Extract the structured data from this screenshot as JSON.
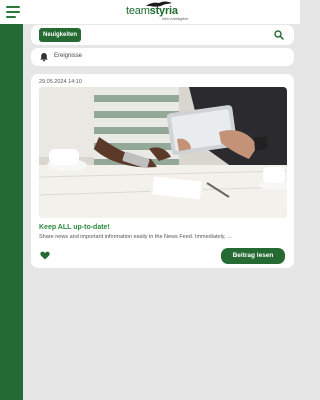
{
  "header": {
    "logo_text_team": "team",
    "logo_text_styria": "styria",
    "logo_sub": "Mein Arbeitgeber"
  },
  "filter": {
    "chip_label": "Neuigkeiten"
  },
  "events": {
    "label": "Ereignisse"
  },
  "post": {
    "date": "29.05.2024 14:10",
    "title": "Keep ALL up-to-date!",
    "excerpt": "Share news and important information easily in the News Feed. Immediately, ...",
    "read_button": "Beitrag lesen",
    "image_alt": "people-with-tablet-photo"
  },
  "colors": {
    "brand_green": "#256a33",
    "sidebar_green": "#236b34",
    "title_green": "#2b8a3e",
    "background": "#e6e6e6"
  },
  "icons": [
    "hamburger-menu-icon",
    "search-icon",
    "bell-icon",
    "heart-icon"
  ]
}
